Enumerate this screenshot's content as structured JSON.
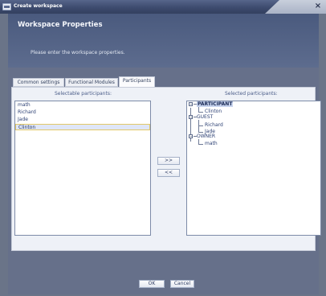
{
  "window": {
    "title": "Create workspace",
    "close_glyph": "×",
    "icon": "app-window-icon"
  },
  "header": {
    "title": "Workspace Properties",
    "description": "Please enter the workspace properties."
  },
  "tabs": [
    {
      "label": "Common settings",
      "active": false
    },
    {
      "label": "Functional Modules",
      "active": false
    },
    {
      "label": "Participants",
      "active": true
    }
  ],
  "selectable": {
    "label": "Selectable participants:",
    "items": [
      "math",
      "Richard",
      "Jade",
      "Clinton"
    ],
    "selected_index": 3
  },
  "selected": {
    "label": "Selected participants:",
    "tree": [
      {
        "label": "PARTICIPANT",
        "children": [
          "Clinton"
        ]
      },
      {
        "label": "GUEST",
        "children": [
          "Richard",
          "Jade"
        ]
      },
      {
        "label": "OWNER",
        "children": [
          "math"
        ]
      }
    ]
  },
  "buttons": {
    "add": ">>",
    "remove": "<<",
    "ok": "OK",
    "cancel": "Cancel"
  },
  "colors": {
    "titlebar": "#3d4b6e",
    "header": "#4e5e80",
    "panel": "#eef1f7",
    "selection_border": "#e2c868"
  }
}
